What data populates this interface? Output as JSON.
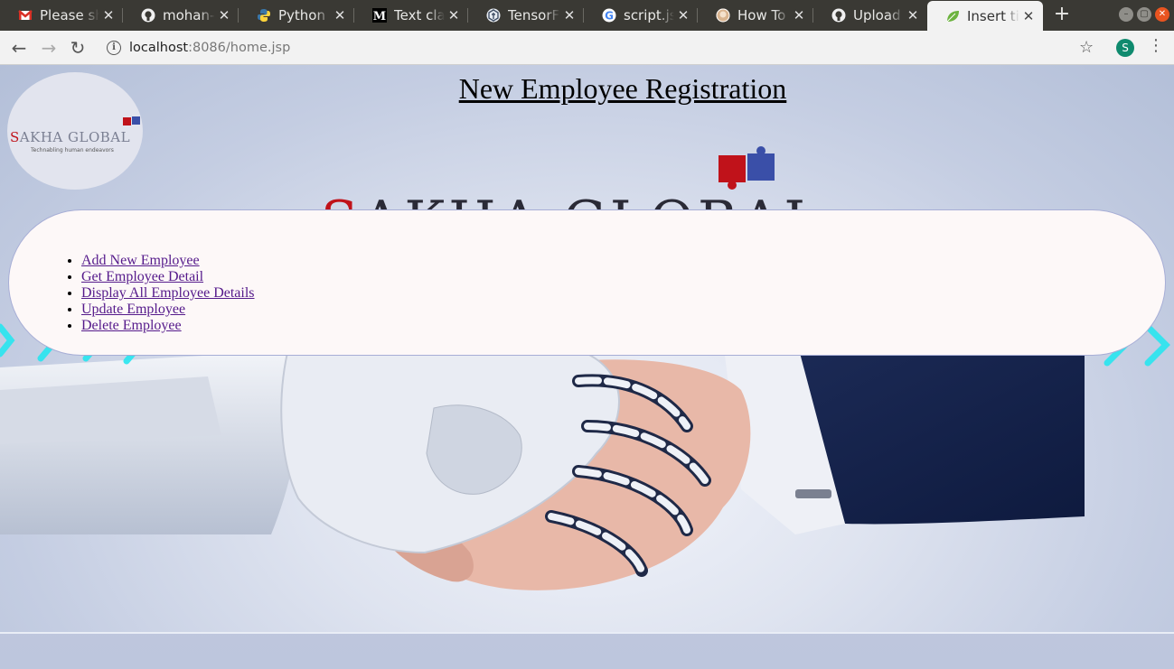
{
  "browser": {
    "tabs": [
      {
        "title": "Please sh",
        "icon": "gmail-icon",
        "active": false
      },
      {
        "title": "mohan-m",
        "icon": "github-icon",
        "active": false
      },
      {
        "title": "Python P",
        "icon": "python-icon",
        "active": false
      },
      {
        "title": "Text class",
        "icon": "medium-icon",
        "active": false
      },
      {
        "title": "TensorFlo",
        "icon": "tensorflow-icon",
        "active": false
      },
      {
        "title": "script.js r",
        "icon": "google-icon",
        "active": false
      },
      {
        "title": "How To I",
        "icon": "site-avatar-icon",
        "active": false
      },
      {
        "title": "Upload fi",
        "icon": "github-icon",
        "active": false
      },
      {
        "title": "Insert titl",
        "icon": "leaf-icon",
        "active": true
      }
    ],
    "address": {
      "host": "localhost",
      "rest": ":8086/home.jsp"
    },
    "profile_initial": "S"
  },
  "page": {
    "heading": "New Employee Registration",
    "logo": {
      "name_first": "S",
      "name_rest": "AKHA GLOBAL",
      "tagline": "Technabling human endeavors"
    },
    "background_title": {
      "first": "S",
      "rest": "AKHA GLOBAL"
    },
    "menu": [
      "Add New Employee",
      "Get Employee Detail",
      "Display All Employee Details",
      "Update Employee",
      "Delete Employee"
    ]
  },
  "colors": {
    "brand_red": "#c0121a",
    "brand_blue": "#3a4fa8",
    "link_visited": "#551a8b",
    "panel_bg": "#fdf8f8"
  }
}
